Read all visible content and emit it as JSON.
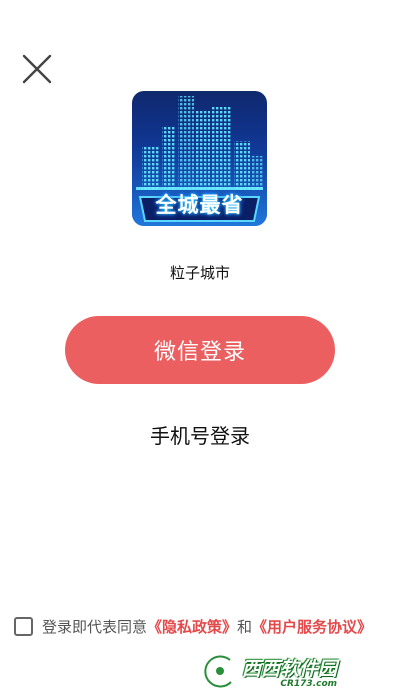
{
  "header": {
    "close_icon": "close-icon"
  },
  "logo": {
    "text": "全城最省",
    "bg_color": "#0a2a86",
    "glow_color": "#2ad6ff"
  },
  "app": {
    "name": "粒子城市"
  },
  "buttons": {
    "wechat_label": "微信登录",
    "wechat_color": "#ec5f61",
    "phone_label": "手机号登录"
  },
  "agreement": {
    "prefix": "登录即代表同意",
    "privacy_link": "《隐私政策》",
    "connector": "和",
    "service_link": "《用户服务协议》",
    "link_color": "#e44a4c"
  },
  "watermark": {
    "main": "西西软件园",
    "sub": "CR173.com"
  }
}
